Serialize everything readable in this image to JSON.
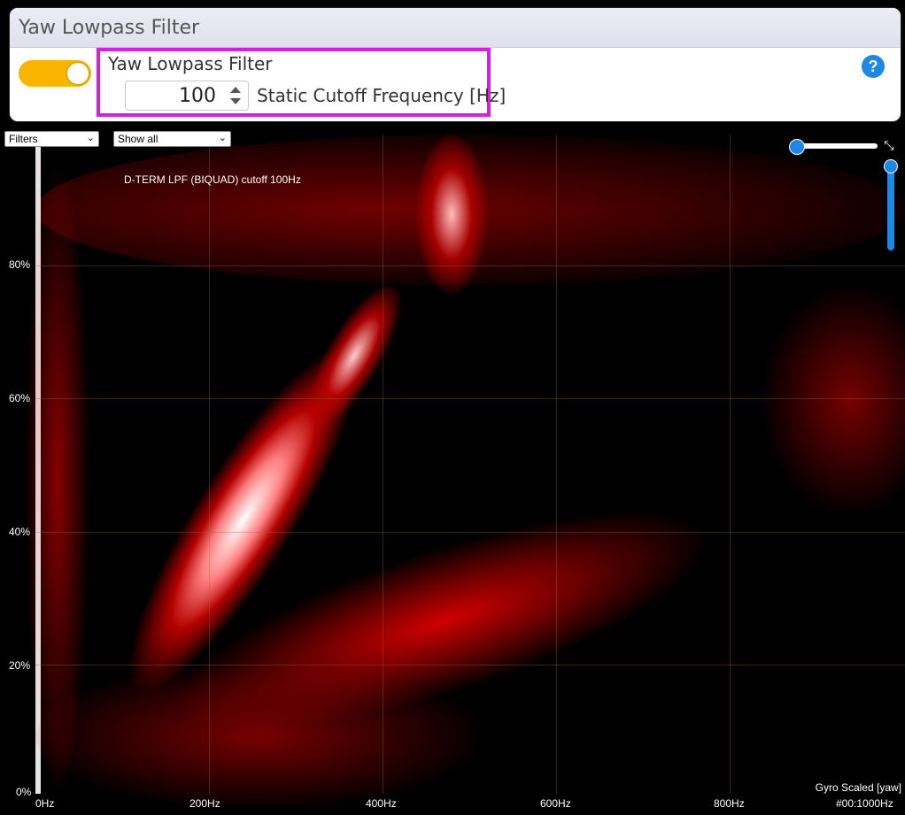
{
  "panel": {
    "title": "Yaw Lowpass Filter",
    "filter_label": "Yaw Lowpass Filter",
    "cutoff_value": "100",
    "cutoff_label": "Static Cutoff Frequency [Hz]",
    "toggle_on": true,
    "help_label": "?"
  },
  "spectrum": {
    "filters_select": "Filters",
    "show_select": "Show all",
    "legend": "D-TERM LPF (BIQUAD) cutoff 100Hz",
    "y_labels": [
      "80%",
      "60%",
      "40%",
      "20%",
      "0%"
    ],
    "x_labels": [
      "0Hz",
      "200Hz",
      "400Hz",
      "600Hz",
      "800Hz",
      "#00:1000Hz"
    ],
    "trace_label": "Gyro Scaled [yaw]"
  },
  "colors": {
    "toggle": "#f7b500",
    "highlight": "#d61fe0",
    "accent": "#1e88e5"
  },
  "icons": {
    "expand": "expand-icon",
    "help": "help-icon"
  }
}
